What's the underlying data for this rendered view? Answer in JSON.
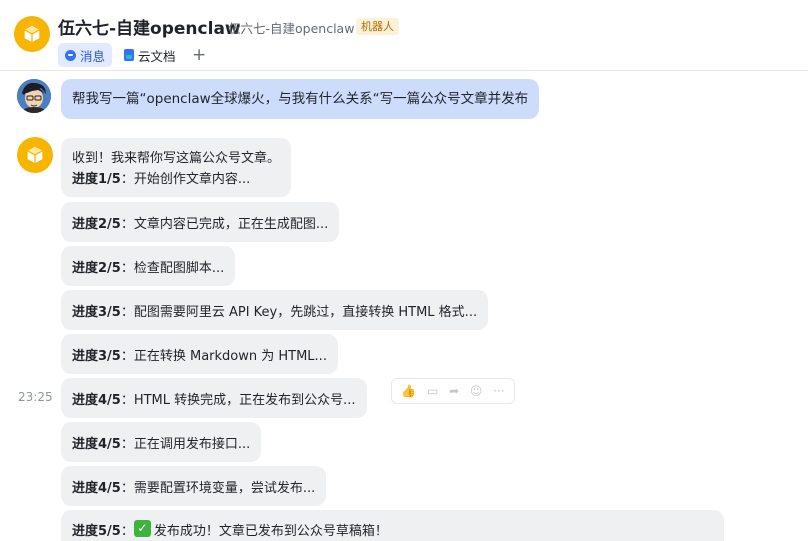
{
  "header": {
    "title": "伍六七-自建openclaw",
    "subtitle": "伍六七-自建openclaw",
    "badge": "机器人",
    "avatar_color": "#F7B500",
    "tabs": [
      {
        "label": "消息",
        "icon": "message-icon",
        "active": true
      },
      {
        "label": "云文档",
        "icon": "doc-icon",
        "active": false
      }
    ],
    "add_tab_label": "+"
  },
  "user_message": "帮我写一篇“openclaw全球爆火，与我有什么关系“写一篇公众号文章并发布",
  "bot_messages": {
    "first_line": "收到！我来帮你写这篇公众号文章。",
    "progress": [
      {
        "label": "进度1/5",
        "text": "：开始创作文章内容..."
      },
      {
        "label": "进度2/5",
        "text": "：文章内容已完成，正在生成配图..."
      },
      {
        "label": "进度2/5",
        "text": "：检查配图脚本..."
      },
      {
        "label": "进度3/5",
        "text": "：配图需要阿里云 API Key，先跳过，直接转换 HTML 格式..."
      },
      {
        "label": "进度3/5",
        "text": "：正在转换 Markdown 为 HTML..."
      },
      {
        "label": "进度4/5",
        "text": "：HTML 转换完成，正在发布到公众号..."
      },
      {
        "label": "进度4/5",
        "text": "：正在调用发布接口..."
      },
      {
        "label": "进度4/5",
        "text": "：需要配置环境变量，尝试发布..."
      },
      {
        "label": "进度5/5",
        "text": "：",
        "check": "✓",
        "text2": "发布成功！文章已发布到公众号草稿箱！"
      }
    ]
  },
  "timestamp": "23:25",
  "colors": {
    "accent": "#3370FF",
    "user_bubble": "#CDDCFB",
    "bot_bubble": "#EFF0F1",
    "success": "#3DB33D"
  }
}
